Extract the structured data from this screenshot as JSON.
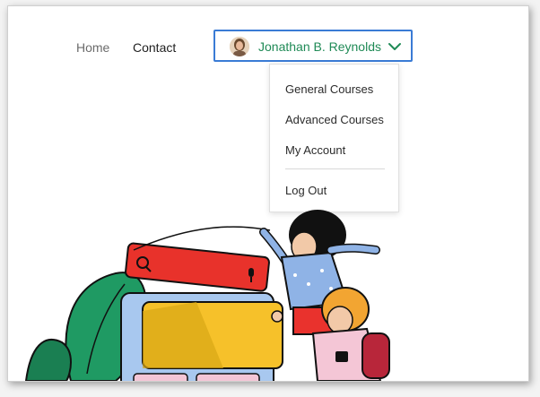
{
  "nav": {
    "home_label": "Home",
    "contact_label": "Contact"
  },
  "user": {
    "name": "Jonathan B. Reynolds"
  },
  "menu": {
    "items": [
      {
        "label": "General Courses"
      },
      {
        "label": "Advanced Courses"
      },
      {
        "label": "My Account"
      },
      {
        "label": "Log Out"
      }
    ]
  },
  "colors": {
    "accent_border": "#3a7bd5",
    "user_name": "#1f8a56"
  },
  "icons": [
    "chevron-down-icon",
    "search-icon",
    "microphone-icon",
    "avatar"
  ]
}
